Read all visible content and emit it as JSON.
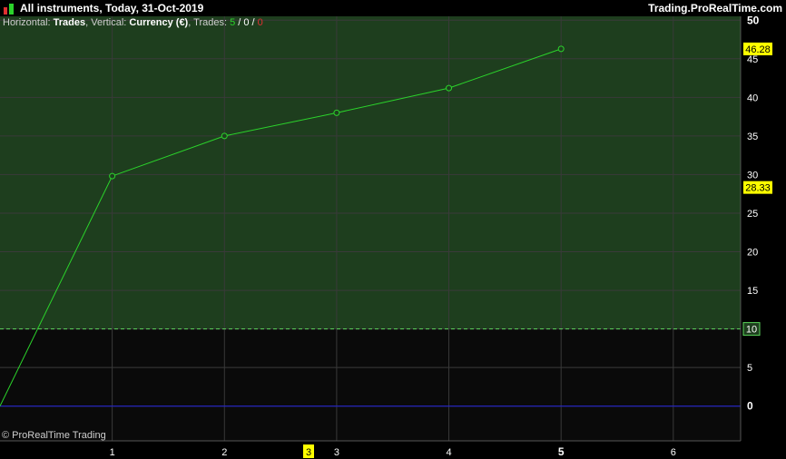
{
  "header": {
    "title": "All instruments, Today, 31-Oct-2019",
    "brand": "Trading.ProRealTime.com"
  },
  "info": {
    "horizontal_label": "Horizontal:",
    "horizontal_value": "Trades",
    "vertical_label": ", Vertical:",
    "vertical_value": "Currency (€)",
    "trades_label": ", Trades:",
    "trades_win": "5",
    "sep1": " / ",
    "trades_neutral": "0",
    "sep2": " / ",
    "trades_loss": "0"
  },
  "copyright": "© ProRealTime Trading",
  "colors": {
    "line": "#2bd32b",
    "fill_above": "#1e3e1e",
    "fill_below": "#0a0a0a",
    "grid": "#3a3a3a",
    "zero_line": "#2222dd",
    "threshold_line": "#5cd65c",
    "label_yellow": "#ffff00"
  },
  "chart_data": {
    "type": "line",
    "x": [
      0,
      1,
      2,
      3,
      4,
      5
    ],
    "y": [
      0,
      29.8,
      35.0,
      38.0,
      41.2,
      46.28
    ],
    "xticks": [
      "1",
      "2",
      "3",
      "4",
      "5",
      "6"
    ],
    "xtick_values": [
      1,
      2,
      3,
      4,
      5,
      6
    ],
    "bold_xtick": "5",
    "yticks": [
      "0",
      "5",
      "10",
      "15",
      "20",
      "25",
      "30",
      "35",
      "40",
      "45",
      "50"
    ],
    "ytick_values": [
      0,
      5,
      10,
      15,
      20,
      25,
      30,
      35,
      40,
      45,
      50
    ],
    "xlim": [
      0,
      6.6
    ],
    "ylim": [
      -4.5,
      50.5
    ],
    "threshold": 10,
    "threshold_label": "10",
    "current_value_label": "46.28",
    "average_value": 28.33,
    "average_label": "28.33",
    "cursor_x": 2.75,
    "cursor_label": "3",
    "grid": true
  }
}
